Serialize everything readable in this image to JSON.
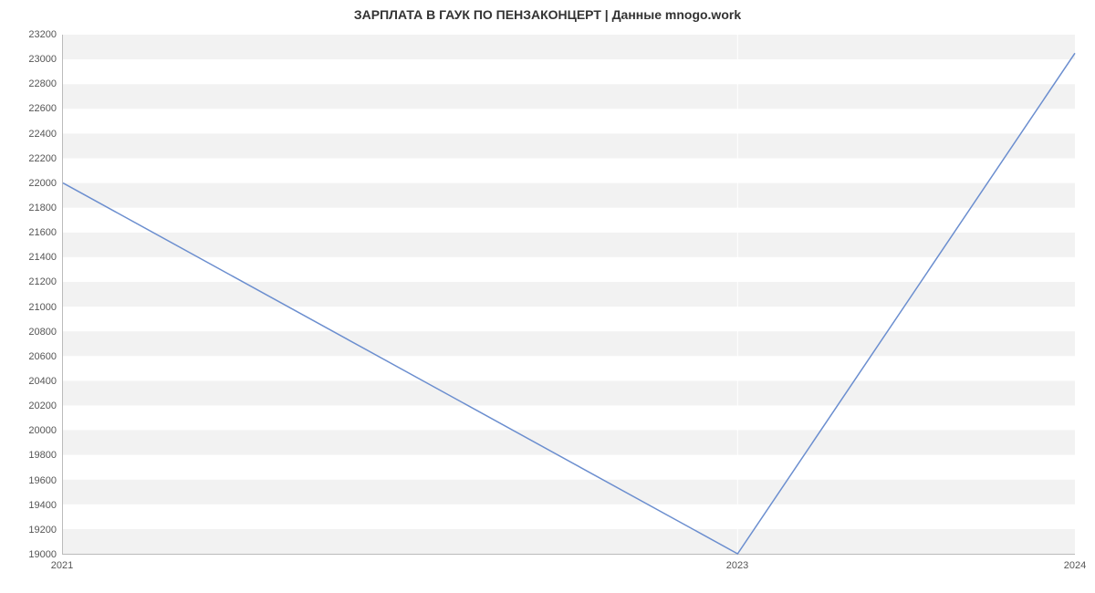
{
  "chart_data": {
    "type": "line",
    "title": "ЗАРПЛАТА В ГАУК ПО ПЕНЗАКОНЦЕРТ | Данные mnogo.work",
    "x": [
      2021,
      2023,
      2024
    ],
    "values": [
      22000,
      19000,
      23050
    ],
    "xlabel": "",
    "ylabel": "",
    "xlim": [
      2021,
      2024
    ],
    "ylim": [
      19000,
      23200
    ],
    "x_ticks": [
      2021,
      2023,
      2024
    ],
    "y_ticks": [
      19000,
      19200,
      19400,
      19600,
      19800,
      20000,
      20200,
      20400,
      20600,
      20800,
      21000,
      21200,
      21400,
      21600,
      21800,
      22000,
      22200,
      22400,
      22600,
      22800,
      23000,
      23200
    ],
    "colors": {
      "line": "#6b8ecf",
      "band": "#f2f2f2"
    }
  }
}
